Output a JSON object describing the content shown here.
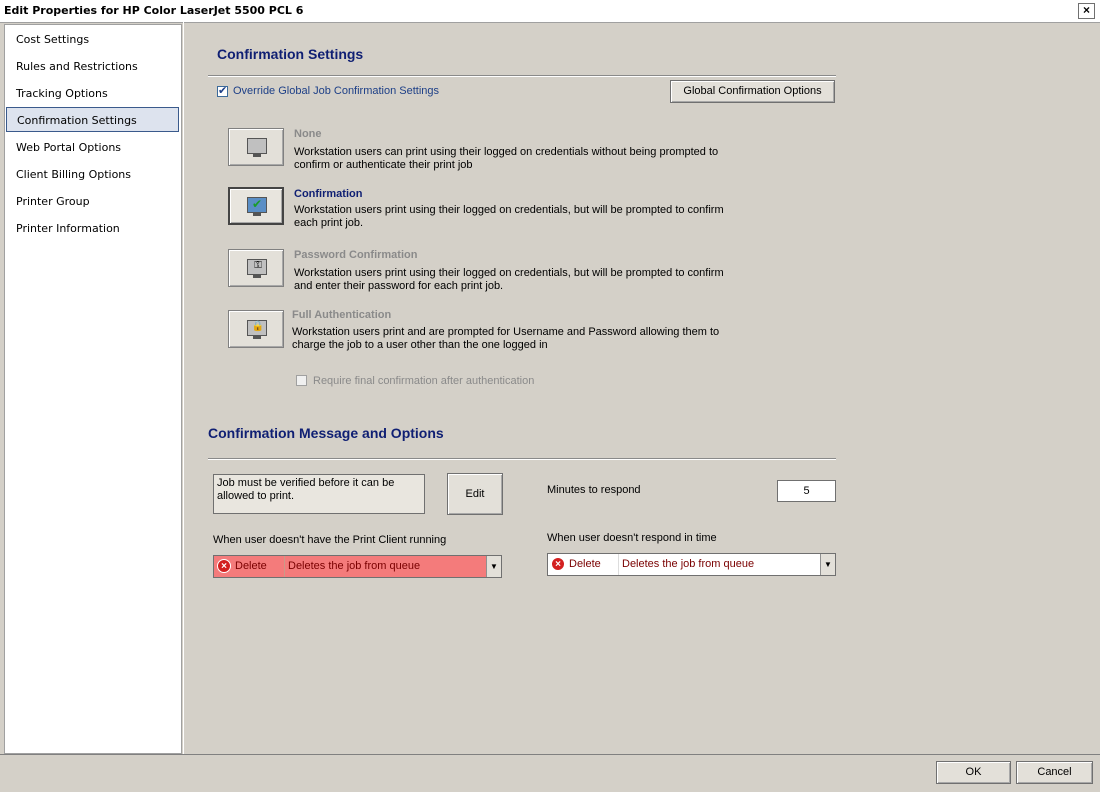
{
  "window": {
    "title": "Edit Properties for HP Color LaserJet 5500 PCL 6",
    "close_glyph": "×"
  },
  "sidebar": {
    "items": [
      {
        "label": "Cost Settings"
      },
      {
        "label": "Rules and Restrictions"
      },
      {
        "label": "Tracking Options"
      },
      {
        "label": "Confirmation Settings",
        "selected": true
      },
      {
        "label": "Web Portal Options"
      },
      {
        "label": "Client Billing Options"
      },
      {
        "label": "Printer Group"
      },
      {
        "label": "Printer Information"
      }
    ]
  },
  "confirmation": {
    "title": "Confirmation Settings",
    "override_label": "Override Global Job Confirmation Settings",
    "override_checked": true,
    "global_button": "Global Confirmation Options",
    "options": [
      {
        "title": "None",
        "desc": "Workstation users can print using their logged on credentials without being prompted to confirm or authenticate their print job",
        "active": false,
        "icon": "monitor-icon"
      },
      {
        "title": "Confirmation",
        "desc": "Workstation users print using their logged on credentials, but will be prompted to confirm each print job.",
        "active": true,
        "icon": "monitor-check-icon"
      },
      {
        "title": "Password Confirmation",
        "desc": "Workstation users print using their logged on credentials, but will be prompted to confirm and enter their password for each print job.",
        "active": false,
        "icon": "monitor-key-icon"
      },
      {
        "title": "Full Authentication",
        "desc": "Workstation users print and are prompted for Username and Password allowing them to charge the job to a user other than the one logged in",
        "active": false,
        "icon": "monitor-lock-icon"
      }
    ],
    "require_final_label": "Require final confirmation after authentication",
    "require_final_checked": false
  },
  "message": {
    "title": "Confirmation Message and Options",
    "text": "Job must be verified before it can be allowed to print.",
    "edit_button": "Edit",
    "minutes_label": "Minutes to respond",
    "minutes_value": "5",
    "no_client_label": "When user doesn't have the Print Client running",
    "no_client_action": "Delete",
    "no_client_desc": "Deletes the job from queue",
    "no_response_label": "When user doesn't respond in time",
    "no_response_action": "Delete",
    "no_response_desc": "Deletes the job from queue"
  },
  "footer": {
    "ok": "OK",
    "cancel": "Cancel"
  },
  "colors": {
    "title_blue": "#0f1f73",
    "dialog_bg": "#d4d0c8",
    "error_red": "#d32020",
    "combo_red_bg": "#f47b7b"
  }
}
